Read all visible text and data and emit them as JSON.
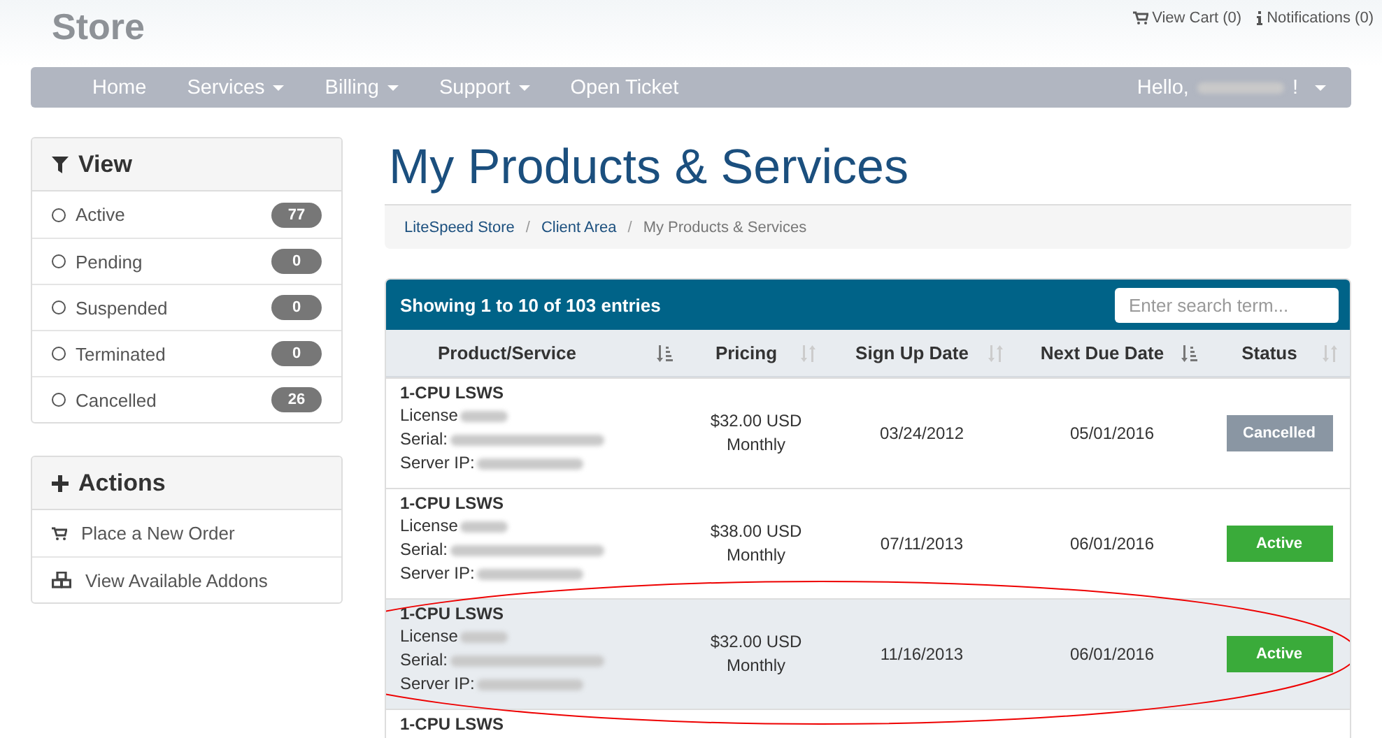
{
  "header": {
    "logo": "Store",
    "links": [
      {
        "kind": "cart",
        "label": "View Cart (0)"
      },
      {
        "kind": "info",
        "label": "Notifications (0)"
      }
    ]
  },
  "nav": {
    "items": [
      {
        "label": "Home",
        "dropdown": false
      },
      {
        "label": "Services",
        "dropdown": true
      },
      {
        "label": "Billing",
        "dropdown": true
      },
      {
        "label": "Support",
        "dropdown": true
      },
      {
        "label": "Open Ticket",
        "dropdown": false
      }
    ],
    "user": {
      "label": "Hello,",
      "redacted": true,
      "suffix": "!",
      "dropdown": true
    }
  },
  "sidebar": {
    "view": {
      "title": "View",
      "items": [
        {
          "label": "Active",
          "count": "77",
          "selected": false
        },
        {
          "label": "Pending",
          "count": "0",
          "selected": false
        },
        {
          "label": "Suspended",
          "count": "0",
          "selected": false
        },
        {
          "label": "Terminated",
          "count": "0",
          "selected": false
        },
        {
          "label": "Cancelled",
          "count": "26",
          "selected": false
        }
      ]
    },
    "actions": {
      "title": "Actions",
      "items": [
        {
          "kind": "cart",
          "label": "Place a New Order"
        },
        {
          "kind": "cubes",
          "label": "View Available Addons"
        }
      ]
    }
  },
  "page_title": "My Products & Services",
  "breadcrumb": [
    {
      "label": "LiteSpeed Store",
      "current": false
    },
    {
      "separator": "/",
      "label": "Client Area",
      "current": false
    },
    {
      "separator": "/",
      "label": "My Products & Services",
      "current": true
    }
  ],
  "table": {
    "summary": "Showing 1 to 10 of 103 entries",
    "search": {
      "placeholder": "Enter search term..."
    },
    "columns": [
      {
        "label": "Product/Service",
        "sorted": true
      },
      {
        "label": "Pricing",
        "sorted": false
      },
      {
        "label": "Sign Up Date",
        "sorted": false
      },
      {
        "label": "Next Due Date",
        "sorted": true
      },
      {
        "label": "Status",
        "sorted": false
      }
    ],
    "rows": [
      {
        "product": "1-CPU LSWS",
        "details": [
          "License",
          "Serial:",
          "Server IP:"
        ],
        "price": "$32.00 USD",
        "cycle": "Monthly",
        "signup": "03/24/2012",
        "due": "05/01/2016",
        "status": {
          "label": "Cancelled",
          "kind": "cancelled"
        },
        "highlighted": false,
        "circled": false
      },
      {
        "product": "1-CPU LSWS",
        "details": [
          "License",
          "Serial:",
          "Server IP:"
        ],
        "price": "$38.00 USD",
        "cycle": "Monthly",
        "signup": "07/11/2013",
        "due": "06/01/2016",
        "status": {
          "label": "Active",
          "kind": "active"
        },
        "highlighted": false,
        "circled": false
      },
      {
        "product": "1-CPU LSWS",
        "details": [
          "License",
          "Serial:",
          "Server IP:"
        ],
        "price": "$32.00 USD",
        "cycle": "Monthly",
        "signup": "11/16/2013",
        "due": "06/01/2016",
        "status": {
          "label": "Active",
          "kind": "active"
        },
        "highlighted": true,
        "circled": true
      },
      {
        "product": "1-CPU LSWS",
        "details": [],
        "highlighted": false,
        "circled": false
      }
    ]
  }
}
